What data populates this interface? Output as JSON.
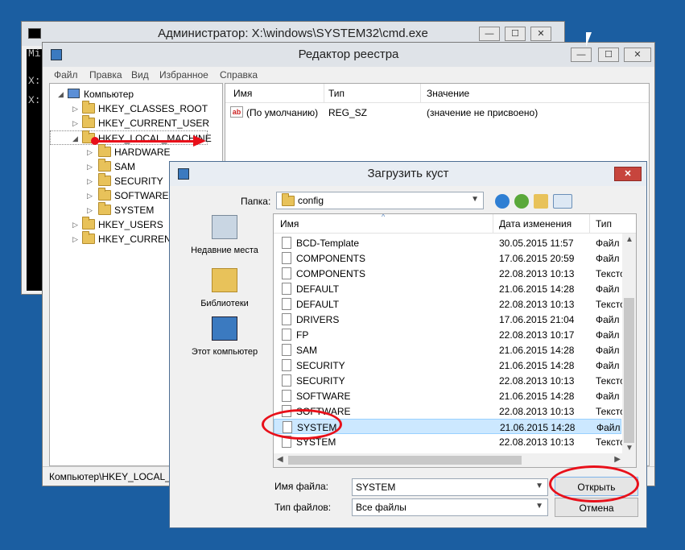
{
  "cmd": {
    "title": "Администратор: X:\\windows\\SYSTEM32\\cmd.exe",
    "icon": "cmd-icon",
    "lines": [
      "Mi",
      "X:",
      "X:"
    ]
  },
  "regedit": {
    "title": "Редактор реестра",
    "icon": "regedit-icon",
    "menu": [
      "Файл",
      "Правка",
      "Вид",
      "Избранное",
      "Справка"
    ],
    "tree": [
      {
        "label": "Компьютер",
        "expander": "◢"
      },
      {
        "label": "HKEY_CLASSES_ROOT",
        "expander": "▷"
      },
      {
        "label": "HKEY_CURRENT_USER",
        "expander": "▷"
      },
      {
        "label": "HKEY_LOCAL_MACHINE",
        "expander": "◢"
      },
      {
        "label": "HARDWARE",
        "expander": "▷"
      },
      {
        "label": "SAM",
        "expander": "▷"
      },
      {
        "label": "SECURITY",
        "expander": "▷"
      },
      {
        "label": "SOFTWARE",
        "expander": "▷"
      },
      {
        "label": "SYSTEM",
        "expander": "▷"
      },
      {
        "label": "HKEY_USERS",
        "expander": "▷"
      },
      {
        "label": "HKEY_CURRENT",
        "expander": "▷"
      }
    ],
    "columns": {
      "name": "Имя",
      "type": "Тип",
      "value": "Значение"
    },
    "values": [
      {
        "name": "(По умолчанию)",
        "type": "REG_SZ",
        "value": "(значение не присвоено)"
      }
    ],
    "status": "Компьютер\\HKEY_LOCAL_M"
  },
  "dialog": {
    "title": "Загрузить куст",
    "close_glyph": "✕",
    "folder_label": "Папка:",
    "folder_value": "config",
    "places": [
      {
        "label": "Недавние места",
        "icon": "recent-places-icon"
      },
      {
        "label": "Библиотеки",
        "icon": "libraries-icon"
      },
      {
        "label": "Этот компьютер",
        "icon": "this-pc-icon"
      }
    ],
    "columns": {
      "name": "Имя",
      "date": "Дата изменения",
      "type": "Тип"
    },
    "files": [
      {
        "name": "BCD-Template",
        "date": "30.05.2015 11:57",
        "type": "Файл"
      },
      {
        "name": "COMPONENTS",
        "date": "17.06.2015 20:59",
        "type": "Файл"
      },
      {
        "name": "COMPONENTS",
        "date": "22.08.2013 10:13",
        "type": "Тексто"
      },
      {
        "name": "DEFAULT",
        "date": "21.06.2015 14:28",
        "type": "Файл"
      },
      {
        "name": "DEFAULT",
        "date": "22.08.2013 10:13",
        "type": "Тексто"
      },
      {
        "name": "DRIVERS",
        "date": "17.06.2015 21:04",
        "type": "Файл"
      },
      {
        "name": "FP",
        "date": "22.08.2013 10:17",
        "type": "Файл"
      },
      {
        "name": "SAM",
        "date": "21.06.2015 14:28",
        "type": "Файл"
      },
      {
        "name": "SECURITY",
        "date": "21.06.2015 14:28",
        "type": "Файл"
      },
      {
        "name": "SECURITY",
        "date": "22.08.2013 10:13",
        "type": "Тексто"
      },
      {
        "name": "SOFTWARE",
        "date": "21.06.2015 14:28",
        "type": "Файл"
      },
      {
        "name": "SOFTWARE",
        "date": "22.08.2013 10:13",
        "type": "Тексто"
      },
      {
        "name": "SYSTEM",
        "date": "21.06.2015 14:28",
        "type": "Файл"
      },
      {
        "name": "SYSTEM",
        "date": "22.08.2013 10:13",
        "type": "Тексто"
      }
    ],
    "selected_index": 12,
    "filename_label": "Имя файла:",
    "filename_value": "SYSTEM",
    "filetype_label": "Тип файлов:",
    "filetype_value": "Все файлы",
    "open_button": "Открыть",
    "cancel_button": "Отмена"
  },
  "window_controls": {
    "minimize": "—",
    "maximize": "☐",
    "close": "✕"
  },
  "colors": {
    "desktop": "#1b5ea1",
    "annotation": "#e8101a",
    "selection": "#cce8ff"
  }
}
